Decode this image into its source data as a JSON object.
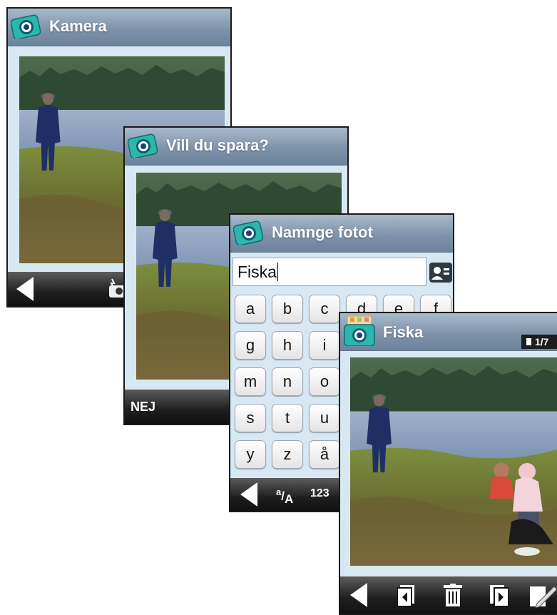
{
  "screens": {
    "kamera": {
      "title": "Kamera"
    },
    "save": {
      "title": "Vill du spara?",
      "no_label": "NEJ"
    },
    "name": {
      "title": "Namnge fotot",
      "input_value": "Fiska",
      "keys": [
        "a",
        "b",
        "c",
        "d",
        "e",
        "f",
        "g",
        "h",
        "i",
        "m",
        "n",
        "o",
        "s",
        "t",
        "u",
        "y",
        "z",
        "å"
      ],
      "case_label": "a/A",
      "numbers_label": "123"
    },
    "viewer": {
      "title": "Fiska",
      "counter": "1/7"
    }
  },
  "icons": {
    "camera": "camera-icon",
    "contacts": "contact-card-icon",
    "back": "back-arrow-icon",
    "flash": "flash-camera-icon",
    "prev": "previous-photo-icon",
    "delete": "trash-icon",
    "next": "next-photo-icon",
    "edit": "pencil-icon"
  }
}
